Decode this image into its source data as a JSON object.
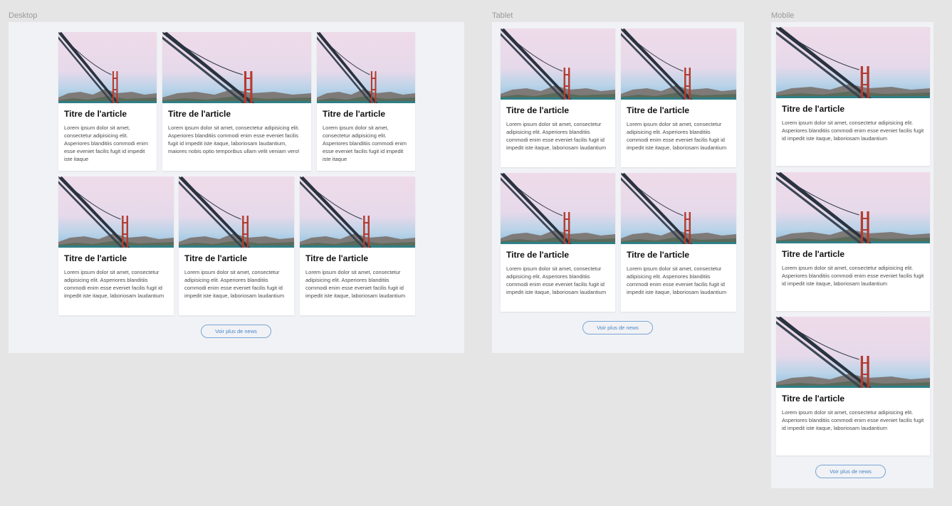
{
  "frames": {
    "desktop": {
      "label": "Desktop"
    },
    "tablet": {
      "label": "Tablet"
    },
    "mobile": {
      "label": "Mobile"
    }
  },
  "card_title": "Titre de l'article",
  "button_label": "Voir plus de news",
  "texts": {
    "narrow": "Lorem ipsum dolor sit amet, consectetur adipisicing elit. Asperiores blanditiis commodi enim esse eveniet facilis fugit id impedit iste itaque",
    "wide": "Lorem ipsum dolor sit amet, consectetur adipisicing elit. Asperiores blanditiis commodi enim esse eveniet facilis fugit id impedit iste itaque, laboriosam laudantium, maiores nobis optio temporibus ullam velit veniam vero!",
    "medium": "Lorem ipsum dolor sit amet, consectetur adipisicing elit. Asperiores blanditiis commodi enim esse eveniet facilis fugit id impedit iste itaque, laboriosam laudantium"
  },
  "image_alt": "golden-gate-bridge-photo"
}
